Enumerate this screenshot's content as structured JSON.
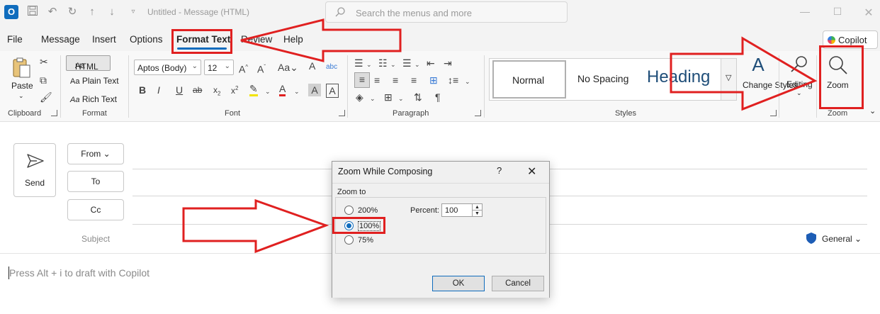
{
  "titlebar": {
    "doc_title": "Untitled  -  Message (HTML)",
    "search_placeholder": "Search the menus and more",
    "app_icon_letter": "O"
  },
  "menu": {
    "tabs": [
      "File",
      "Message",
      "Insert",
      "Options",
      "Format Text",
      "Review",
      "Help"
    ],
    "active_tab": "Format Text",
    "copilot_label": "Copilot"
  },
  "ribbon": {
    "clipboard": {
      "paste_label": "Paste",
      "group_label": "Clipboard"
    },
    "format": {
      "html_label": "HTML",
      "plain_label": "Plain Text",
      "rich_label": "Rich Text",
      "group_label": "Format"
    },
    "font": {
      "font_name": "Aptos (Body)",
      "font_size": "12",
      "group_label": "Font"
    },
    "paragraph": {
      "group_label": "Paragraph"
    },
    "styles": {
      "normal": "Normal",
      "no_spacing": "No Spacing",
      "heading": "Heading",
      "change_styles": "Change Styles",
      "group_label": "Styles"
    },
    "editing": {
      "label": "Editing"
    },
    "zoom": {
      "label": "Zoom",
      "group_label": "Zoom"
    }
  },
  "compose": {
    "send_label": "Send",
    "from_label": "From",
    "to_label": "To",
    "cc_label": "Cc",
    "subject_label": "Subject",
    "sensitivity_label": "General",
    "body_placeholder": "Press Alt + i to draft with Copilot"
  },
  "dialog": {
    "title": "Zoom While Composing",
    "help_label": "?",
    "zoom_to_label": "Zoom to",
    "options": [
      "200%",
      "100%",
      "75%"
    ],
    "selected_option": "100%",
    "percent_label": "Percent:",
    "percent_value": "100",
    "ok_label": "OK",
    "cancel_label": "Cancel"
  },
  "colors": {
    "accent": "#0f6cbd",
    "annotation_red": "#e02020",
    "heading_style": "#1f4e79"
  }
}
